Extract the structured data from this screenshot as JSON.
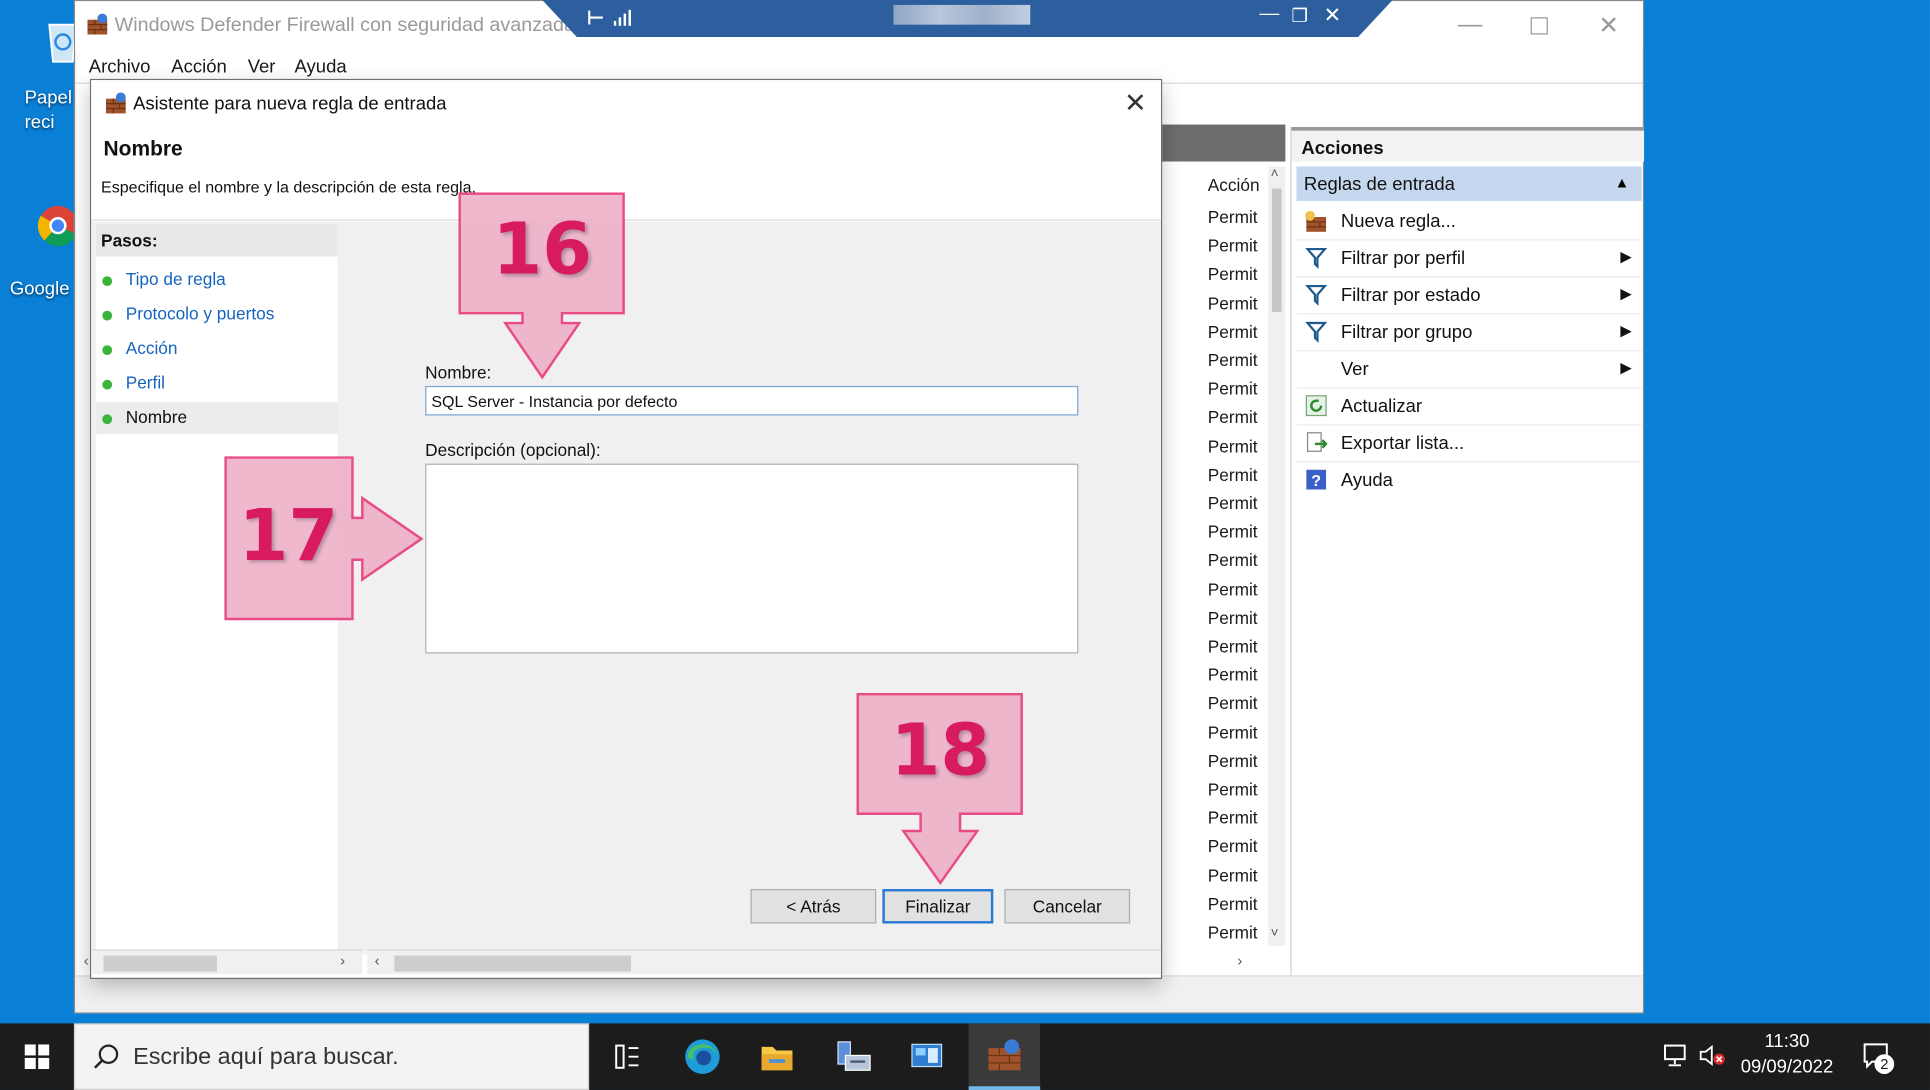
{
  "desktop": {
    "icons": [
      {
        "label": "Papel reci"
      },
      {
        "label": "Google"
      }
    ]
  },
  "mmc": {
    "title": "Windows Defender Firewall con seguridad avanzada",
    "menu": [
      "Archivo",
      "Acción",
      "Ver",
      "Ayuda"
    ],
    "center": {
      "column_header": "Acción",
      "rows": [
        "Permit",
        "Permit",
        "Permit",
        "Permit",
        "Permit",
        "Permit",
        "Permit",
        "Permit",
        "Permit",
        "Permit",
        "Permit",
        "Permit",
        "Permit",
        "Permit",
        "Permit",
        "Permit",
        "Permit",
        "Permit",
        "Permit",
        "Permit",
        "Permit",
        "Permit",
        "Permit",
        "Permit",
        "Permit",
        "Permit"
      ]
    },
    "actions": {
      "title": "Acciones",
      "section": "Reglas de entrada",
      "items": [
        {
          "label": "Nueva regla...",
          "icon": "new-rule-icon"
        },
        {
          "label": "Filtrar por perfil",
          "icon": "filter-icon",
          "submenu": true
        },
        {
          "label": "Filtrar por estado",
          "icon": "filter-icon",
          "submenu": true
        },
        {
          "label": "Filtrar por grupo",
          "icon": "filter-icon",
          "submenu": true
        },
        {
          "label": "Ver",
          "icon": "",
          "submenu": true
        },
        {
          "label": "Actualizar",
          "icon": "refresh-icon"
        },
        {
          "label": "Exportar lista...",
          "icon": "export-icon"
        },
        {
          "label": "Ayuda",
          "icon": "help-icon"
        }
      ]
    }
  },
  "wizard": {
    "title": "Asistente para nueva regla de entrada",
    "heading": "Nombre",
    "description": "Especifique el nombre y la descripción de esta regla.",
    "steps_title": "Pasos:",
    "steps": [
      {
        "label": "Tipo de regla"
      },
      {
        "label": "Protocolo y puertos"
      },
      {
        "label": "Acción"
      },
      {
        "label": "Perfil"
      },
      {
        "label": "Nombre",
        "current": true
      }
    ],
    "name_label": "Nombre:",
    "name_value": "SQL Server - Instancia por defecto",
    "desc_label": "Descripción (opcional):",
    "desc_value": "",
    "buttons": {
      "back": "< Atrás",
      "finish": "Finalizar",
      "cancel": "Cancelar"
    }
  },
  "callouts": [
    "16",
    "17",
    "18"
  ],
  "taskbar": {
    "search_placeholder": "Escribe aquí para buscar.",
    "time": "11:30",
    "date": "09/09/2022",
    "notification_count": "2"
  },
  "colors": {
    "desktop": "#0a7fd6",
    "callout_fill": "#ecacc4",
    "callout_text": "#d81b60",
    "actions_section": "#c5d7ee",
    "link": "#1565c0"
  }
}
